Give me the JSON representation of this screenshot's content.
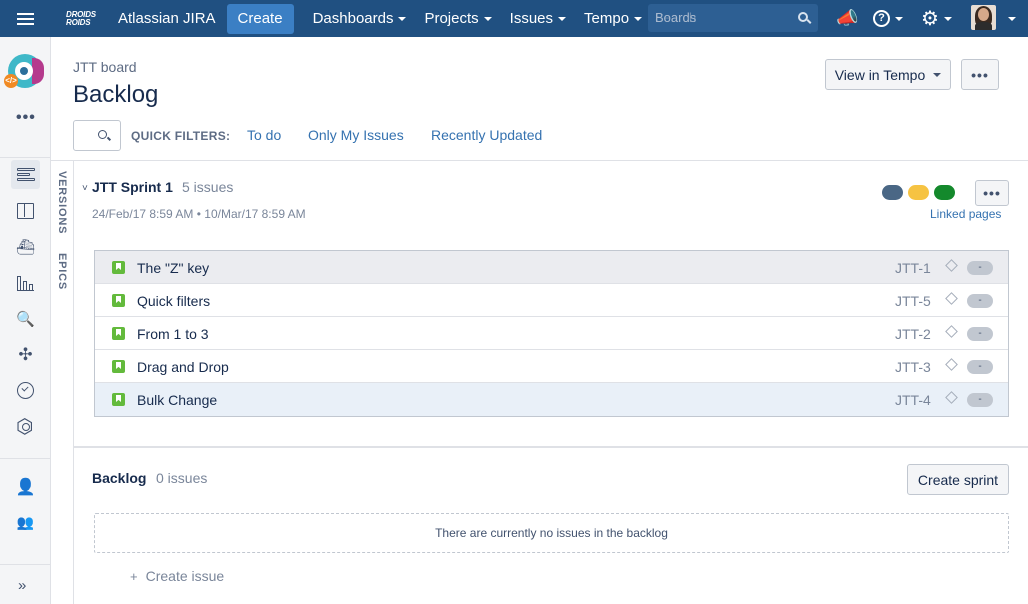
{
  "topnav": {
    "logo_line1": "DROIDS",
    "logo_line2": "ROIDS",
    "app_title": "Atlassian JIRA",
    "create_label": "Create",
    "menu": [
      "Dashboards",
      "Projects",
      "Issues",
      "Tempo"
    ],
    "search_text": "Boards",
    "search_ghost": "Search",
    "help_glyph": "?"
  },
  "sidebar": {
    "more_glyph": "•••",
    "expand_glyph": "»",
    "project_badge": "</>",
    "items": [
      "backlog",
      "active-sprints",
      "releases",
      "reports",
      "issues-filters",
      "components",
      "tempo",
      "add-ons",
      "add-people",
      "teams"
    ]
  },
  "header": {
    "breadcrumb": "JTT board",
    "title": "Backlog",
    "view_in_tempo": "View in Tempo",
    "more": "•••"
  },
  "filters": {
    "label": "QUICK FILTERS:",
    "items": [
      "To do",
      "Only My Issues",
      "Recently Updated"
    ]
  },
  "side_tabs": {
    "versions": "VERSIONS",
    "epics": "EPICS"
  },
  "sprint": {
    "caret": "˅",
    "name": "JTT Sprint 1",
    "count": "5 issues",
    "dates": "24/Feb/17 8:59 AM  •  10/Mar/17 8:59 AM",
    "status_colors": [
      "#4a6785",
      "#f6c342",
      "#14892c"
    ],
    "more": "•••",
    "linked_pages": "Linked pages",
    "issues": [
      {
        "summary": "The \"Z\" key",
        "key": "JTT-1",
        "estimate": "-",
        "state": "hover"
      },
      {
        "summary": "Quick filters",
        "key": "JTT-5",
        "estimate": "-",
        "state": ""
      },
      {
        "summary": "From 1 to 3",
        "key": "JTT-2",
        "estimate": "-",
        "state": ""
      },
      {
        "summary": "Drag and Drop",
        "key": "JTT-3",
        "estimate": "-",
        "state": ""
      },
      {
        "summary": "Bulk Change",
        "key": "JTT-4",
        "estimate": "-",
        "state": "selected"
      }
    ]
  },
  "backlog": {
    "title": "Backlog",
    "count": "0 issues",
    "create_sprint": "Create sprint",
    "empty_message": "There are currently no issues in the backlog",
    "create_issue_plus": "+",
    "create_issue": "Create issue"
  },
  "colors": {
    "nav_bg": "#205081",
    "create_btn": "#3b7fc4",
    "link": "#3572b0",
    "story_icon": "#63ba3c"
  }
}
